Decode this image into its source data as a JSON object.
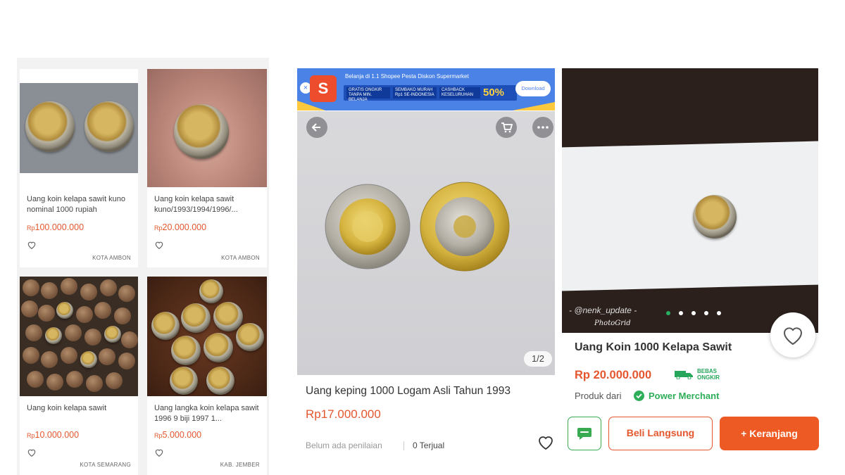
{
  "left_grid": {
    "cards": [
      {
        "title": "Uang koin kelapa sawit kuno nominal 1000 rupiah",
        "currency": "Rp",
        "amount": "100.000.000",
        "location": "KOTA AMBON"
      },
      {
        "title": "Uang koin kelapa sawit kuno/1993/1994/1996/...",
        "currency": "Rp",
        "amount": "20.000.000",
        "location": "KOTA AMBON"
      },
      {
        "title": "Uang koin kelapa sawit",
        "currency": "Rp",
        "amount": "10.000.000",
        "location": "KOTA SEMARANG"
      },
      {
        "title": "Uang langka koin kelapa sawit 1996 9 biji 1997 1...",
        "currency": "Rp",
        "amount": "5.000.000",
        "location": "KAB. JEMBER"
      }
    ]
  },
  "middle": {
    "banner": {
      "logo": "S",
      "close": "×",
      "headline": "Belanja di 1.1 Shopee Pesta Diskon Supermarket",
      "seg1": "GRATIS ONGKIR TANPA MIN. BELANJA",
      "seg2": "SEMBAKO MURAH Rp1 SE-INDONESIA",
      "seg3": "CASHBACK KESELURUHAN",
      "discount": "50%",
      "download_label": "Download"
    },
    "pager": "1/2",
    "title": "Uang keping 1000 Logam Asli Tahun 1993",
    "price": "Rp17.000.000",
    "reviews": "Belum ada penilaian",
    "sold": "0 Terjual"
  },
  "right": {
    "watermark": "- @nenk_update -",
    "watermark2": "PhotoGrid",
    "title": "Uang Koin 1000 Kelapa Sawit",
    "price": "Rp 20.000.000",
    "free_shipping_line1": "BEBAS",
    "free_shipping_line2": "ONGKIR",
    "produk_label": "Produk dari",
    "merchant": "Power Merchant",
    "buy_label": "Beli Langsung",
    "cart_label": "+ Keranjang"
  },
  "colors": {
    "price": "#e4572e",
    "shopee_banner": "#4a82e6",
    "tokopedia_green": "#2eae59",
    "cart_button": "#ee5a24"
  }
}
